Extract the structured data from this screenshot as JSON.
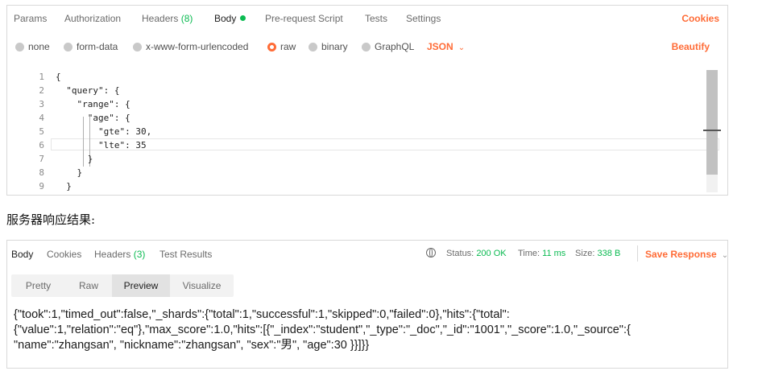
{
  "request": {
    "tabs": [
      {
        "label": "Params"
      },
      {
        "label": "Authorization"
      },
      {
        "label": "Headers",
        "count": "(8)"
      },
      {
        "label": "Body"
      },
      {
        "label": "Pre-request Script"
      },
      {
        "label": "Tests"
      },
      {
        "label": "Settings"
      }
    ],
    "cookies_label": "Cookies",
    "body_types": [
      "none",
      "form-data",
      "x-www-form-urlencoded",
      "raw",
      "binary",
      "GraphQL"
    ],
    "selected_body_type": "raw",
    "language": "JSON",
    "beautify_label": "Beautify",
    "code": {
      "line_numbers": [
        "1",
        "2",
        "3",
        "4",
        "5",
        "6",
        "7",
        "8",
        "9"
      ],
      "lines": [
        "{",
        "  \"query\": {",
        "    \"range\": {",
        "      \"age\": {",
        "        \"gte\": 30,",
        "        \"lte\": 35",
        "      }",
        "    }",
        "  }"
      ]
    }
  },
  "section_heading": "服务器响应结果:",
  "response": {
    "tabs": [
      {
        "label": "Body"
      },
      {
        "label": "Cookies"
      },
      {
        "label": "Headers",
        "count": "(3)"
      },
      {
        "label": "Test Results"
      }
    ],
    "status_label": "Status:",
    "status_value": "200 OK",
    "time_label": "Time:",
    "time_value": "11 ms",
    "size_label": "Size:",
    "size_value": "338 B",
    "save_label": "Save Response",
    "views": [
      "Pretty",
      "Raw",
      "Preview",
      "Visualize"
    ],
    "active_view": "Preview",
    "body_lines": [
      "{\"took\":1,\"timed_out\":false,\"_shards\":{\"total\":1,\"successful\":1,\"skipped\":0,\"failed\":0},\"hits\":{\"total\":",
      "{\"value\":1,\"relation\":\"eq\"},\"max_score\":1.0,\"hits\":[{\"_index\":\"student\",\"_type\":\"_doc\",\"_id\":\"1001\",\"_score\":1.0,\"_source\":{",
      "\"name\":\"zhangsan\", \"nickname\":\"zhangsan\", \"sex\":\"男\", \"age\":30 }}]}}"
    ]
  },
  "colors": {
    "accent": "#ff6c37",
    "success": "#0cbb52"
  }
}
